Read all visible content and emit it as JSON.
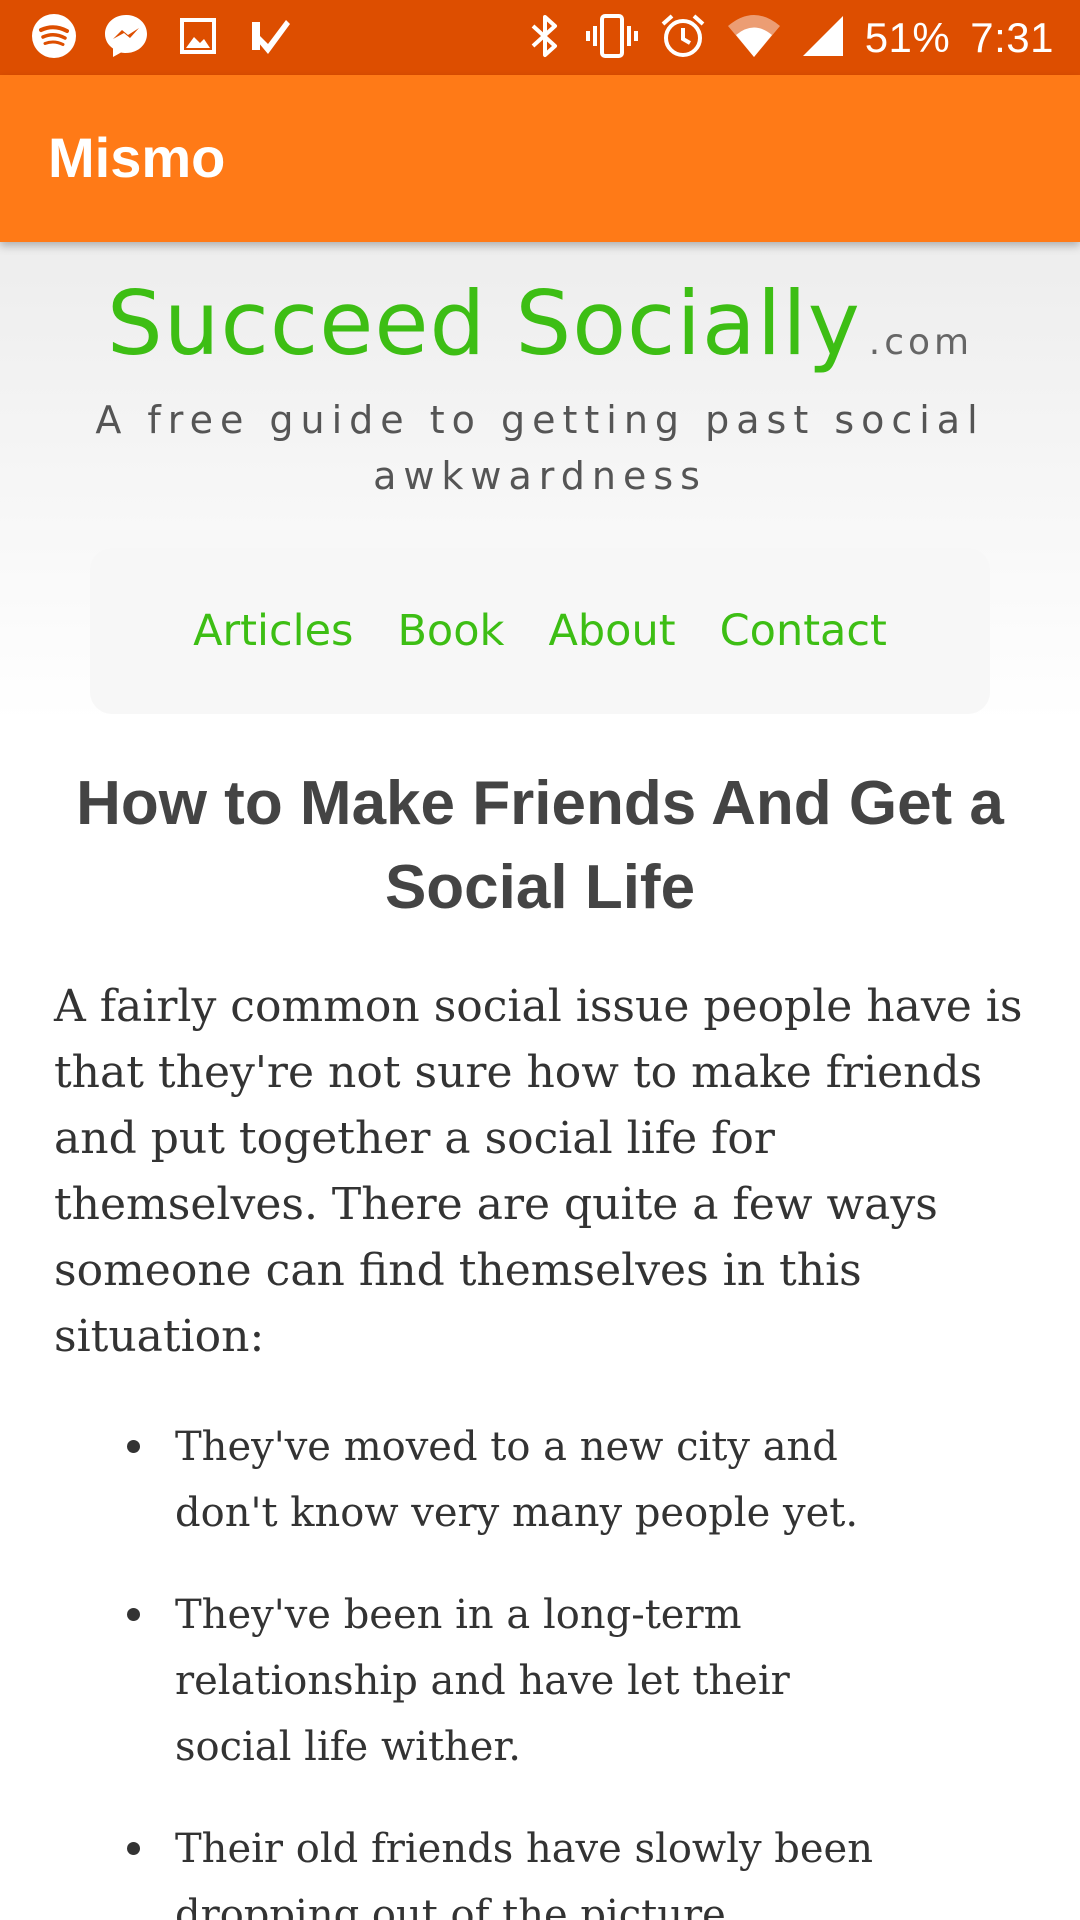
{
  "status_bar": {
    "left_icons": [
      "spotify-icon",
      "messenger-icon",
      "gallery-icon",
      "task-check-icon"
    ],
    "right_icons": [
      "bluetooth-icon",
      "vibrate-icon",
      "alarm-icon",
      "wifi-icon",
      "signal-icon"
    ],
    "battery": "51%",
    "time": "7:31",
    "background_color": "#dd4e00"
  },
  "app_bar": {
    "title": "Mismo",
    "background_color": "#ff7a17"
  },
  "site": {
    "title": "Succeed Socially",
    "suffix": ".com",
    "tagline": "A free guide to getting past social awkwardness",
    "accent_color": "#3dbe14",
    "nav": [
      {
        "label": "Articles"
      },
      {
        "label": "Book"
      },
      {
        "label": "About"
      },
      {
        "label": "Contact"
      }
    ]
  },
  "article": {
    "title": "How to Make Friends And Get a Social Life",
    "intro": "A fairly common social issue people have is that they're not sure how to make friends and put together a social life for themselves. There are quite a few ways someone can find themselves in this situation:",
    "bullets": [
      "They've moved to a new city and don't know very many people yet.",
      "They've been in a long-term relationship and have let their social life wither.",
      "Their old friends have slowly been dropping out of the picture"
    ]
  }
}
